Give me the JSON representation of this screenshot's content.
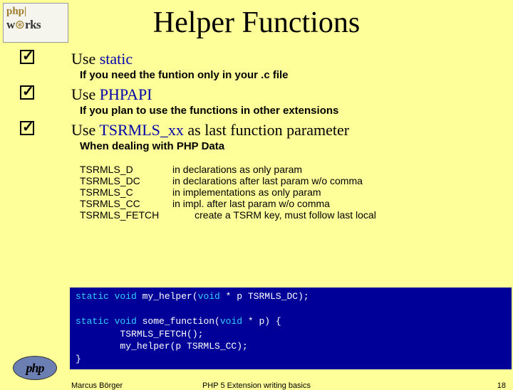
{
  "logo_top": {
    "line1_a": "php",
    "line1_b": "|",
    "line2_a": "w",
    "line2_gear": "⊛",
    "line2_b": "rks"
  },
  "title": "Helper Functions",
  "items": [
    {
      "head_pre": "Use ",
      "kw": "static",
      "head_post": "",
      "sub": "If you need the funtion only in your .c file"
    },
    {
      "head_pre": "Use ",
      "kw": "PHPAPI",
      "head_post": "",
      "sub": "If you plan to use the functions in other extensions"
    },
    {
      "head_pre": "Use ",
      "kw": "TSRMLS_xx",
      "head_post": " as last function parameter",
      "sub": "When dealing with PHP Data"
    }
  ],
  "macros": [
    {
      "name": "TSRMLS_D",
      "desc": "in declarations as only param"
    },
    {
      "name": "TSRMLS_DC",
      "desc": "in declarations after last param w/o comma"
    },
    {
      "name": "TSRMLS_C",
      "desc": "in implementations as only param"
    },
    {
      "name": "TSRMLS_CC",
      "desc": "in impl. after last param w/o comma"
    },
    {
      "name": "TSRMLS_FETCH",
      "desc": "create a TSRM key, must follow last local"
    }
  ],
  "code": {
    "l1a": "static void",
    "l1b": " my_helper(",
    "l1c": "void",
    "l1d": " * p TSRMLS_DC);",
    "l2a": "static void",
    "l2b": " some_function(",
    "l2c": "void",
    "l2d": " * p) {",
    "l3": "        TSRMLS_FETCH();",
    "l4": "        my_helper(p TSRMLS_CC);",
    "l5": "}"
  },
  "footer": {
    "author": "Marcus Börger",
    "mid": "PHP 5 Extension writing basics",
    "page": "18"
  },
  "php_logo": "php"
}
